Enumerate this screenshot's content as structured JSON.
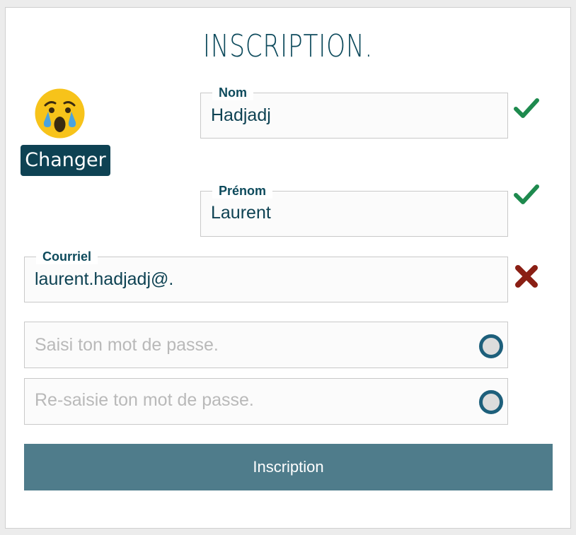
{
  "form": {
    "title": "INSCRIPTION.",
    "avatar": {
      "icon": "crying-face-icon"
    },
    "change_button_label": "Changer",
    "nom": {
      "legend": "Nom",
      "value": "Hadjadj",
      "status": "valid"
    },
    "prenom": {
      "legend": "Prénom",
      "value": "Laurent",
      "status": "valid"
    },
    "courriel": {
      "legend": "Courriel",
      "value": "laurent.hadjadj@.",
      "status": "invalid"
    },
    "password": {
      "placeholder": "Saisi ton mot de passe."
    },
    "password_confirm": {
      "placeholder": "Re-saisie ton mot de passe."
    },
    "submit_label": "Inscription"
  },
  "colors": {
    "primary": "#0e4253",
    "submit_bg": "#4f7c8b",
    "valid": "#1e8a4e",
    "invalid": "#8a1f14",
    "radio": "#1d5f7b"
  }
}
